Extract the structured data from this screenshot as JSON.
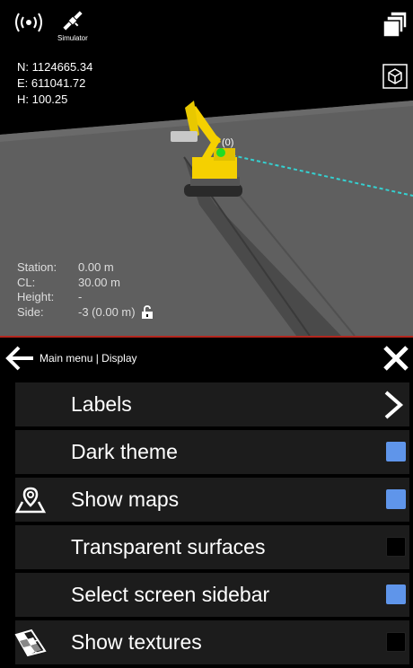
{
  "status": {
    "simulator_label": "Simulator"
  },
  "coords": {
    "n": "N: 1124665.34",
    "e": "E: 611041.72",
    "h": "H: 100.25"
  },
  "machine": {
    "marker_label": "(0)"
  },
  "station_info": [
    {
      "key": "Station:",
      "value": "0.00 m"
    },
    {
      "key": "CL:",
      "value": "30.00 m"
    },
    {
      "key": "Height:",
      "value": "-"
    },
    {
      "key": "Side:",
      "value": "-3 (0.00 m)"
    }
  ],
  "menu": {
    "breadcrumb": "Main menu | Display",
    "items": [
      {
        "label": "Labels",
        "control": "chevron",
        "icon": ""
      },
      {
        "label": "Dark theme",
        "control": "checkbox",
        "checked": true,
        "icon": ""
      },
      {
        "label": "Show maps",
        "control": "checkbox",
        "checked": true,
        "icon": "map-pin-icon"
      },
      {
        "label": "Transparent surfaces",
        "control": "checkbox",
        "checked": false,
        "icon": ""
      },
      {
        "label": "Select screen sidebar",
        "control": "checkbox",
        "checked": true,
        "icon": ""
      },
      {
        "label": "Show textures",
        "control": "checkbox",
        "checked": false,
        "icon": "texture-icon"
      }
    ]
  },
  "colors": {
    "accent": "#5f95ea",
    "divider": "#b3261e",
    "machine": "#f5d000",
    "marker": "#22dd22",
    "guide": "#35d0d0"
  }
}
